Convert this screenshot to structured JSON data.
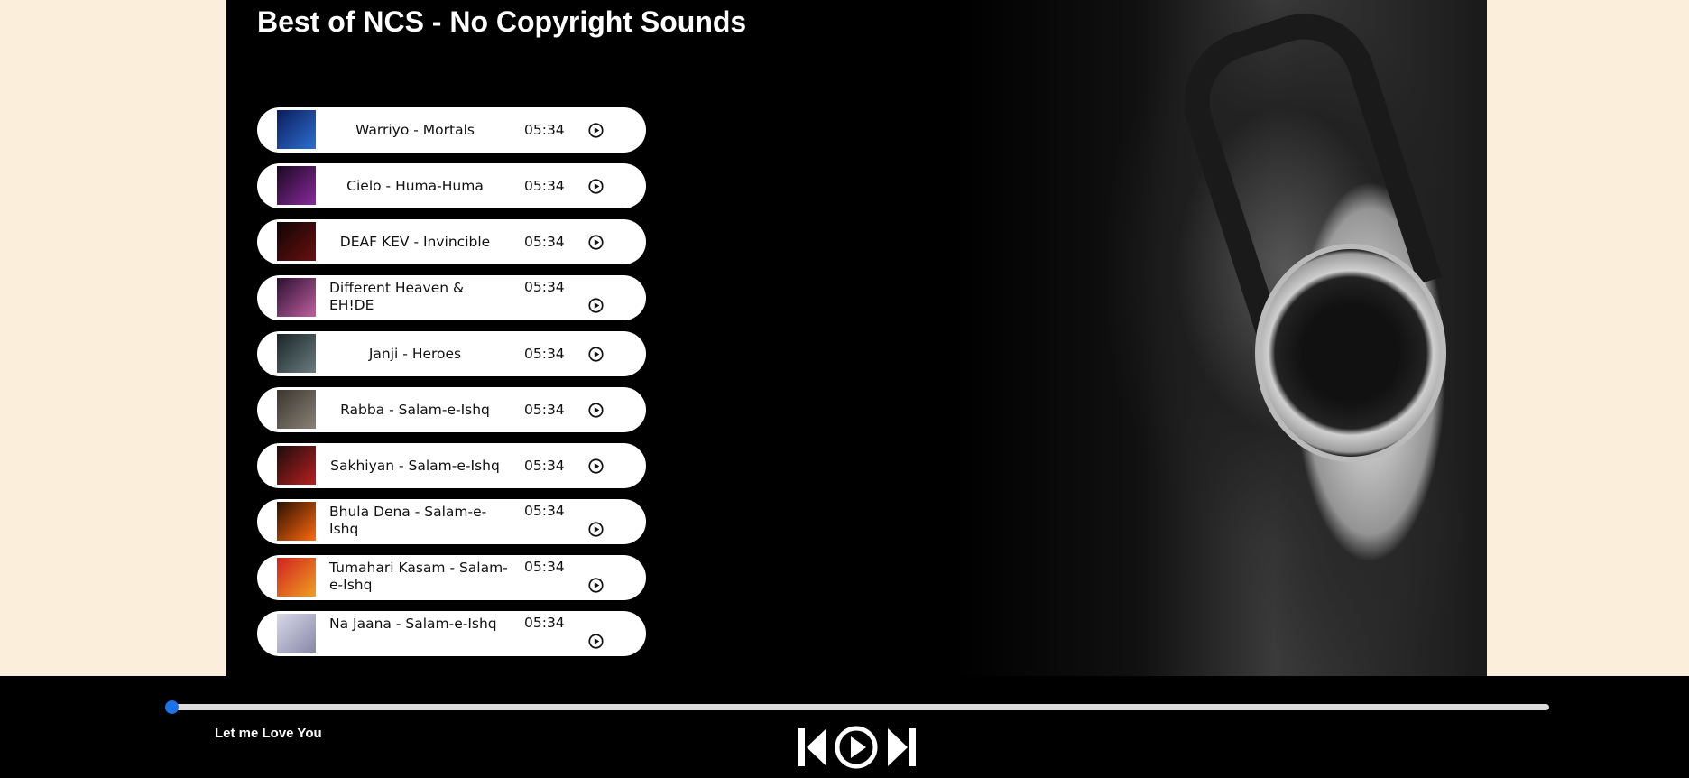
{
  "page": {
    "title": "Best of NCS - No Copyright Sounds"
  },
  "songs": [
    {
      "name": "Warriyo - Mortals",
      "duration": "05:34",
      "wrap": false,
      "thumb": [
        "#0b1c5c",
        "#2d6fd1"
      ]
    },
    {
      "name": "Cielo - Huma-Huma",
      "duration": "05:34",
      "wrap": false,
      "thumb": [
        "#1a0820",
        "#8a2a9e"
      ]
    },
    {
      "name": "DEAF KEV - Invincible",
      "duration": "05:34",
      "wrap": false,
      "thumb": [
        "#100404",
        "#6a1010"
      ]
    },
    {
      "name": "Different Heaven & EH!DE",
      "duration": "05:34",
      "wrap": true,
      "thumb": [
        "#2a1030",
        "#c060a0"
      ]
    },
    {
      "name": "Janji - Heroes",
      "duration": "05:34",
      "wrap": false,
      "thumb": [
        "#1a2528",
        "#6a7c80"
      ]
    },
    {
      "name": "Rabba - Salam-e-Ishq",
      "duration": "05:34",
      "wrap": false,
      "thumb": [
        "#3a3530",
        "#8a8275"
      ]
    },
    {
      "name": "Sakhiyan - Salam-e-Ishq",
      "duration": "05:34",
      "wrap": false,
      "thumb": [
        "#1c0c0c",
        "#b82020"
      ]
    },
    {
      "name": "Bhula Dena - Salam-e-Ishq",
      "duration": "05:34",
      "wrap": true,
      "thumb": [
        "#2a1000",
        "#ff6a10"
      ]
    },
    {
      "name": "Tumahari Kasam - Salam-e-Ishq",
      "duration": "05:34",
      "wrap": true,
      "thumb": [
        "#d02020",
        "#f0a020"
      ]
    },
    {
      "name": "Na Jaana - Salam-e-Ishq",
      "duration": "05:34",
      "wrap": true,
      "thumb": [
        "#d8d8e8",
        "#8888a8"
      ]
    }
  ],
  "player": {
    "now_playing": "Let me Love You",
    "progress": 0,
    "accent_color": "#1a73e8",
    "controls": [
      "previous-icon",
      "play-icon",
      "next-icon"
    ]
  }
}
